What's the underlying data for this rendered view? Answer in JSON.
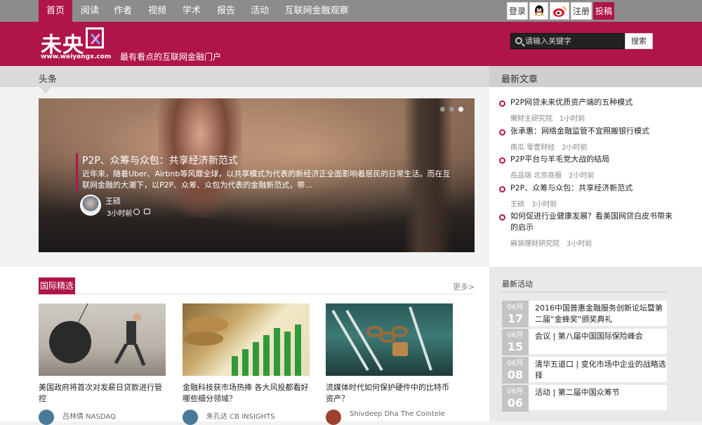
{
  "nav": {
    "items": [
      "首页",
      "阅读",
      "作者",
      "视频",
      "学术",
      "报告",
      "活动",
      "互联网金融观察"
    ],
    "active": "首页",
    "login": "登录",
    "register": "注册",
    "submit": "投稿",
    "social_icons": [
      "qq-icon",
      "weibo-icon"
    ]
  },
  "header": {
    "logo_text": "未央",
    "logo_url": "www.weiyangx.com",
    "slogan": "最有看点的互联网金融门户",
    "search_placeholder": "请输入关键字",
    "search_button": "搜索"
  },
  "headline": {
    "label": "头条",
    "title": "P2P、众筹与众包：共享经济新范式",
    "summary": "近年来，随着Uber、Airbnb等风靡全球，以共享模式为代表的新经济正全面影响着居民的日常生活。而在互联网金融的大潮下，以P2P、众筹、众包为代表的金融新范式，带...",
    "author": "王硕",
    "time": "3小时前"
  },
  "latest": {
    "label": "最新文章",
    "items": [
      {
        "title": "P2P网贷未来优质资产端的五种模式",
        "source": "懒财主研究院",
        "time": "1小时前"
      },
      {
        "title": "张承惠：网络金融监管不宜照搬银行模式",
        "source": "南瓜 零壹财经",
        "time": "2小时前"
      },
      {
        "title": "P2P平台与羊毛党大战的结局",
        "source": "岳品瑞 北京商报",
        "time": "2小时前"
      },
      {
        "title": "P2P、众筹与众包：共享经济新范式",
        "source": "王硕",
        "time": "3小时前"
      },
      {
        "title": "如何促进行业健康发展？看美国网贷白皮书带来的启示",
        "source": "麻袋理财研究院",
        "time": "3小时前"
      }
    ]
  },
  "international": {
    "label": "国际精选",
    "more": "更多>",
    "cards": [
      {
        "title": "美国政府将首次对发薪日贷款进行管控",
        "author": "吕林倩 NASDAQ"
      },
      {
        "title": "金融科技获市场热捧 各大风投都看好哪些细分领域？",
        "author": "朱孔达 CB INSIGHTS"
      },
      {
        "title": "流媒体时代如何保护硬件中的比特币资产？",
        "author": "Shivdeep Dha The Cointele"
      }
    ]
  },
  "activities": {
    "label": "最新活动",
    "items": [
      {
        "month": "06月",
        "day": "17",
        "title": "2016中国普惠金融服务创新论坛暨第二届“金蜂奖”颁奖典礼"
      },
      {
        "month": "06月",
        "day": "15",
        "title": "会议 | 第八届中国国际保险峰会"
      },
      {
        "month": "06月",
        "day": "08",
        "title": "清华五道口 | 变化市场中企业的战略选择"
      },
      {
        "month": "06月",
        "day": "06",
        "title": "活动 | 第二届中国众筹节"
      }
    ]
  },
  "colors": {
    "brand": "#b0154a",
    "nav_bg": "#8c8c8c"
  }
}
